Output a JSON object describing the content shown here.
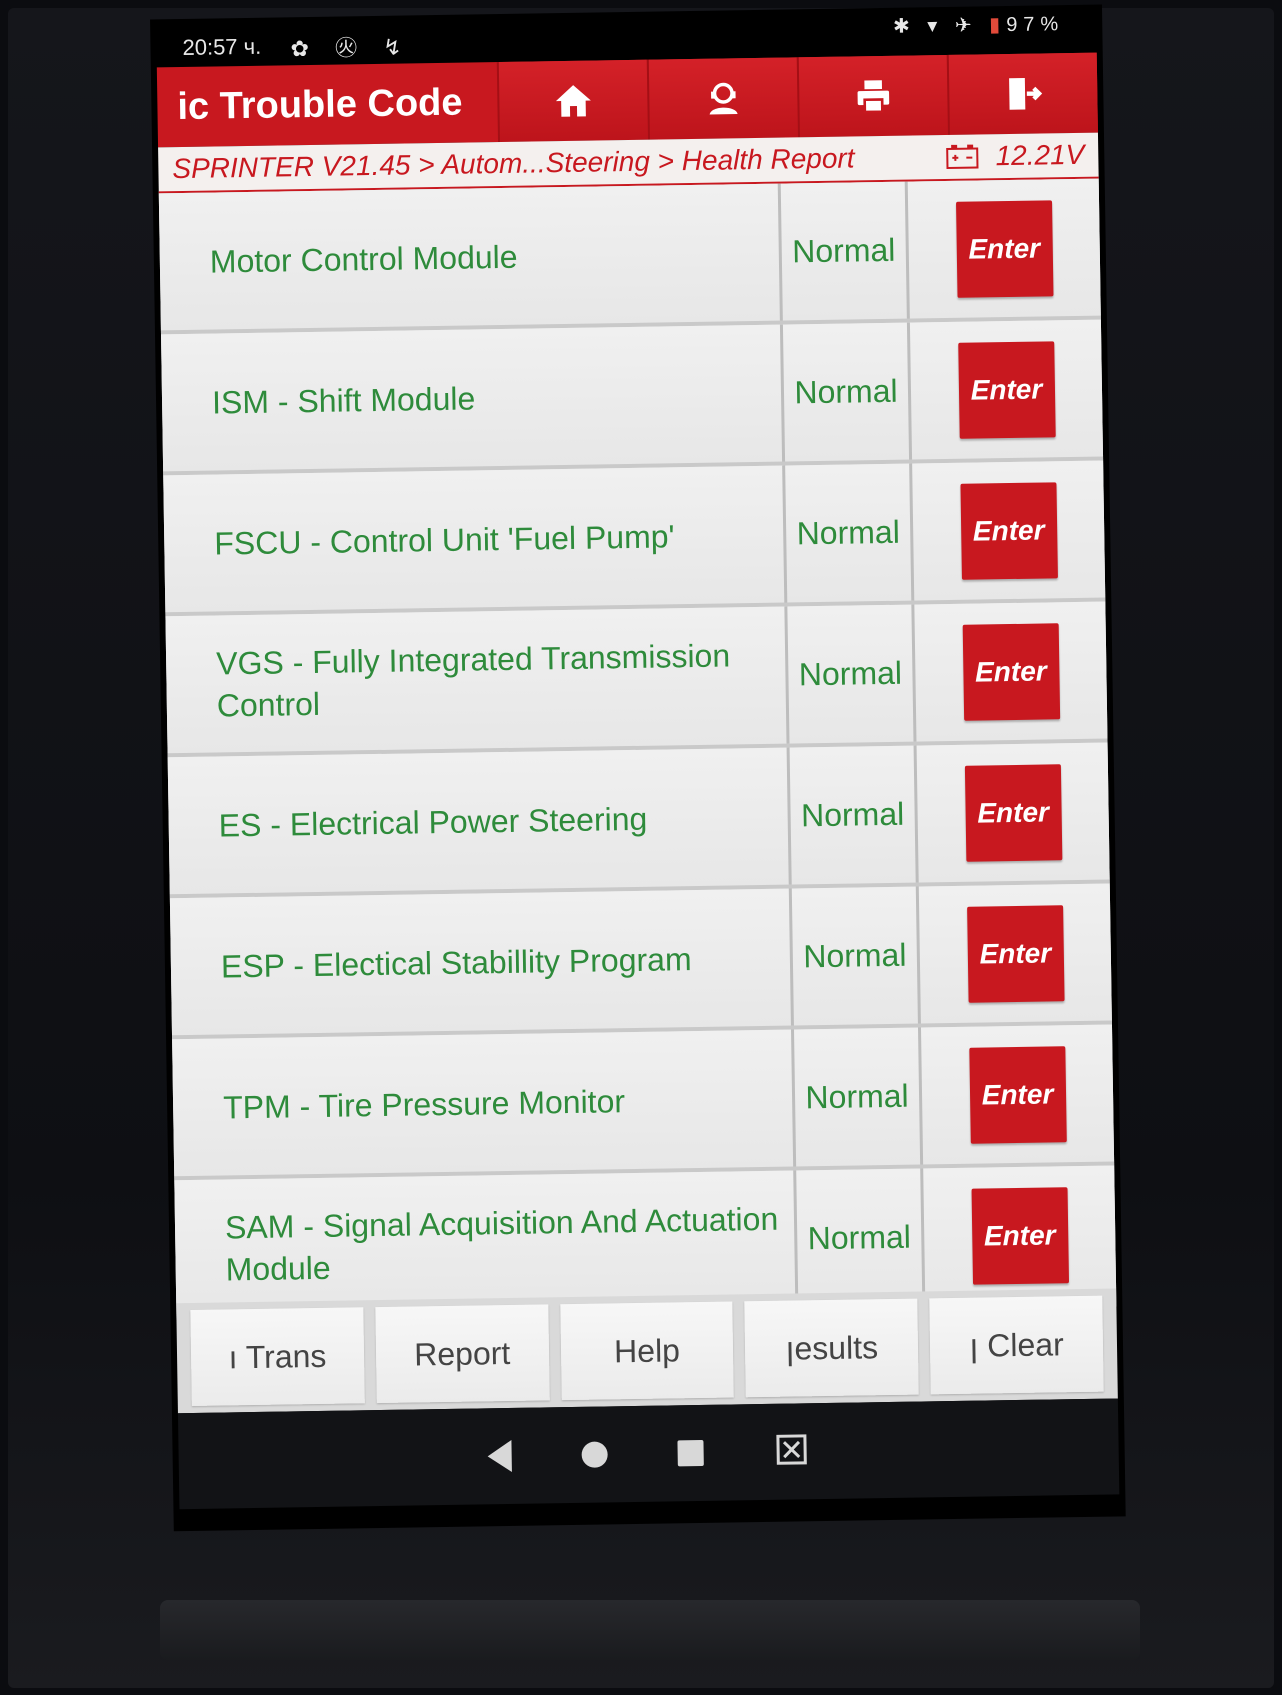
{
  "status_bar": {
    "time": "20:57 ч.",
    "left_icons": "✿ ㊋ ↯",
    "right_icons": "✱ ▾ ✈",
    "battery": "97%"
  },
  "header": {
    "title": "ic Trouble Code",
    "buttons": [
      {
        "icon": "home-icon"
      },
      {
        "icon": "support-icon"
      },
      {
        "icon": "print-icon"
      },
      {
        "icon": "exit-icon"
      }
    ]
  },
  "breadcrumb": {
    "path": "SPRINTER V21.45 > Autom...Steering > Health Report",
    "voltage": "12.21V"
  },
  "modules": [
    {
      "name": "Motor Control Module",
      "status": "Normal",
      "action": "Enter"
    },
    {
      "name": "ISM -  Shift Module",
      "status": "Normal",
      "action": "Enter"
    },
    {
      "name": "FSCU -  Control Unit 'Fuel Pump'",
      "status": "Normal",
      "action": "Enter"
    },
    {
      "name": "VGS -  Fully Integrated Transmission Control",
      "status": "Normal",
      "action": "Enter"
    },
    {
      "name": "ES -  Electrical Power Steering",
      "status": "Normal",
      "action": "Enter"
    },
    {
      "name": "ESP -  Electical Stabillity Program",
      "status": "Normal",
      "action": "Enter"
    },
    {
      "name": "TPM -  Tire Pressure Monitor",
      "status": "Normal",
      "action": "Enter"
    },
    {
      "name": "SAM -  Signal Acquisition And Actuation Module",
      "status": "Normal",
      "action": "Enter"
    }
  ],
  "toolbar": {
    "buttons": [
      "ı   Trans",
      "Report",
      "Help",
      "ꞁesults",
      "ꞁ    Clear"
    ]
  },
  "colors": {
    "brand_red": "#c8181f",
    "status_green": "#2e8b3b"
  }
}
